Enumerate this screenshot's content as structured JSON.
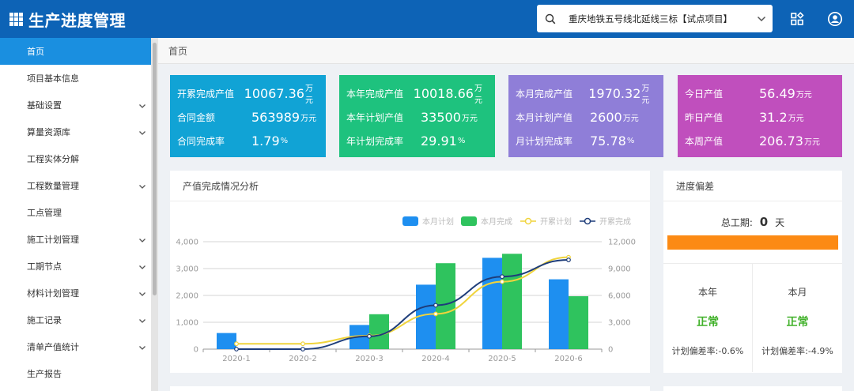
{
  "app": {
    "title": "生产进度管理"
  },
  "project_select": {
    "value": "重庆地铁五号线北延线三标【试点项目】"
  },
  "sidebar": {
    "items": [
      {
        "label": "首页",
        "active": true,
        "expandable": false
      },
      {
        "label": "项目基本信息",
        "active": false,
        "expandable": false
      },
      {
        "label": "基础设置",
        "active": false,
        "expandable": true
      },
      {
        "label": "算量资源库",
        "active": false,
        "expandable": true
      },
      {
        "label": "工程实体分解",
        "active": false,
        "expandable": false
      },
      {
        "label": "工程数量管理",
        "active": false,
        "expandable": true
      },
      {
        "label": "工点管理",
        "active": false,
        "expandable": false
      },
      {
        "label": "施工计划管理",
        "active": false,
        "expandable": true
      },
      {
        "label": "工期节点",
        "active": false,
        "expandable": true
      },
      {
        "label": "材料计划管理",
        "active": false,
        "expandable": true
      },
      {
        "label": "施工记录",
        "active": false,
        "expandable": true
      },
      {
        "label": "清单产值统计",
        "active": false,
        "expandable": true
      },
      {
        "label": "生产报告",
        "active": false,
        "expandable": false
      }
    ]
  },
  "breadcrumb": "首页",
  "cards": [
    {
      "color": "#11a3d5",
      "rows": [
        {
          "label": "开累完成产值",
          "value": "10067.36",
          "unit": "万元"
        },
        {
          "label": "合同金额",
          "value": "563989",
          "unit": "万元"
        },
        {
          "label": "合同完成率",
          "value": "1.79",
          "unit": "%"
        }
      ]
    },
    {
      "color": "#1ec27e",
      "rows": [
        {
          "label": "本年完成产值",
          "value": "10018.66",
          "unit": "万元"
        },
        {
          "label": "本年计划产值",
          "value": "33500",
          "unit": "万元"
        },
        {
          "label": "年计划完成率",
          "value": "29.91",
          "unit": "%"
        }
      ]
    },
    {
      "color": "#8f7ed8",
      "rows": [
        {
          "label": "本月完成产值",
          "value": "1970.32",
          "unit": "万元"
        },
        {
          "label": "本月计划产值",
          "value": "2600",
          "unit": "万元"
        },
        {
          "label": "月计划完成率",
          "value": "75.78",
          "unit": "%"
        }
      ]
    },
    {
      "color": "#c04fbd",
      "rows": [
        {
          "label": "今日产值",
          "value": "56.49",
          "unit": "万元"
        },
        {
          "label": "昨日产值",
          "value": "31.2",
          "unit": "万元"
        },
        {
          "label": "本周产值",
          "value": "206.73",
          "unit": "万元"
        }
      ]
    }
  ],
  "chart_panel": {
    "title": "产值完成情况分析"
  },
  "chart_data": {
    "type": "bar",
    "categories": [
      "2020-1",
      "2020-2",
      "2020-3",
      "2020-4",
      "2020-5",
      "2020-6"
    ],
    "series": [
      {
        "name": "本月计划",
        "type": "bar",
        "axis": "left",
        "color": "#1e8ff0",
        "values": [
          600,
          0,
          900,
          2400,
          3400,
          2600
        ]
      },
      {
        "name": "本月完成",
        "type": "bar",
        "axis": "left",
        "color": "#2fc35e",
        "values": [
          0,
          0,
          1300,
          3200,
          3550,
          1970
        ]
      },
      {
        "name": "开累计划",
        "type": "line",
        "axis": "right",
        "color": "#f0d43c",
        "values": [
          1800,
          1800,
          4500,
          11800,
          22600,
          30800
        ]
      },
      {
        "name": "开累完成",
        "type": "line",
        "axis": "right",
        "color": "#1e3d7a",
        "values": [
          0,
          0,
          4300,
          14700,
          24300,
          29900
        ]
      }
    ],
    "y_left": {
      "min": 0,
      "max": 4000,
      "ticks": [
        "0",
        "1,000",
        "2,000",
        "3,000",
        "4,000"
      ]
    },
    "y_right": {
      "min": 0,
      "max": 36000,
      "ticks": [
        "0",
        "3,000",
        "6,000",
        "9,000",
        "12,000"
      ]
    },
    "legend_position": "top-right",
    "grid": true
  },
  "deviation": {
    "title": "进度偏差",
    "total_label": "总工期:",
    "total_value": "0",
    "total_unit": "天",
    "year": {
      "label": "本年",
      "status": "正常",
      "rate_label": "计划偏差率:",
      "rate": "-0.6%"
    },
    "month": {
      "label": "本月",
      "status": "正常",
      "rate_label": "计划偏差率:",
      "rate": "-4.9%"
    }
  }
}
